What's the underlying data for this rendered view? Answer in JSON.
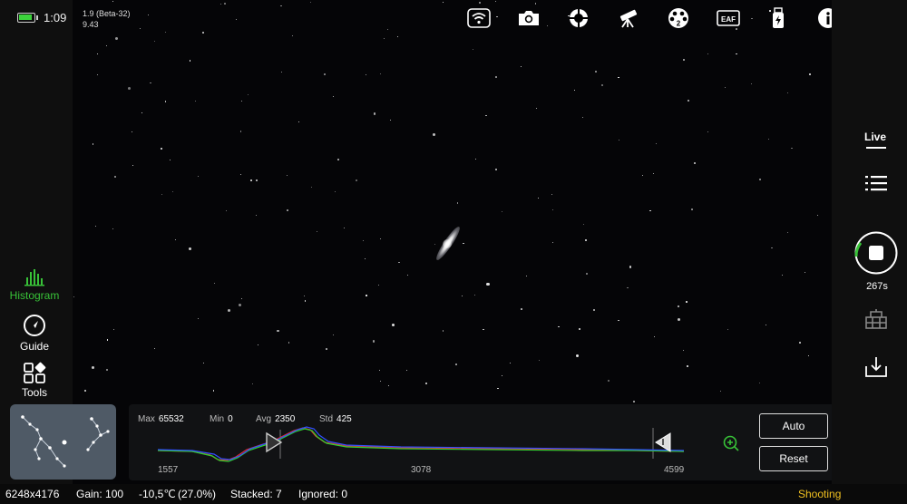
{
  "status": {
    "time": "1:09",
    "battery_level": 0.95,
    "version_line1": "1.9 (Beta-32)",
    "version_line2": "9.43"
  },
  "toolbar_icons": [
    "wifi-icon",
    "camera-icon",
    "guide-target-icon",
    "telescope-icon",
    "filter-wheel-icon",
    "eaf-focuser-icon",
    "usb-power-icon",
    "info-icon"
  ],
  "toolbar": {
    "filter_wheel_position": "2",
    "eaf_label": "EAF"
  },
  "nav": {
    "histogram": "Histogram",
    "guide": "Guide",
    "tools": "Tools"
  },
  "histogram": {
    "max_label": "Max",
    "max_value": "65532",
    "min_label": "Min",
    "min_value": "0",
    "avg_label": "Avg",
    "avg_value": "2350",
    "std_label": "Std",
    "std_value": "425",
    "axis_left": "1557",
    "axis_mid": "3078",
    "axis_right": "4599",
    "auto_label": "Auto",
    "reset_label": "Reset"
  },
  "right_panel": {
    "live_label": "Live",
    "exposure_time": "267s"
  },
  "footer": {
    "resolution": "6248x4176",
    "gain": "Gain: 100",
    "temperature": "-10,5℃",
    "cooler_power": "(27.0%)",
    "stacked": "Stacked: 7",
    "ignored": "Ignored: 0",
    "state": "Shooting"
  },
  "colors": {
    "accent_green": "#38c238",
    "state_yellow": "#f0c020",
    "histogram_red": "#e03030",
    "histogram_green": "#30d030",
    "histogram_blue": "#3050ff"
  }
}
